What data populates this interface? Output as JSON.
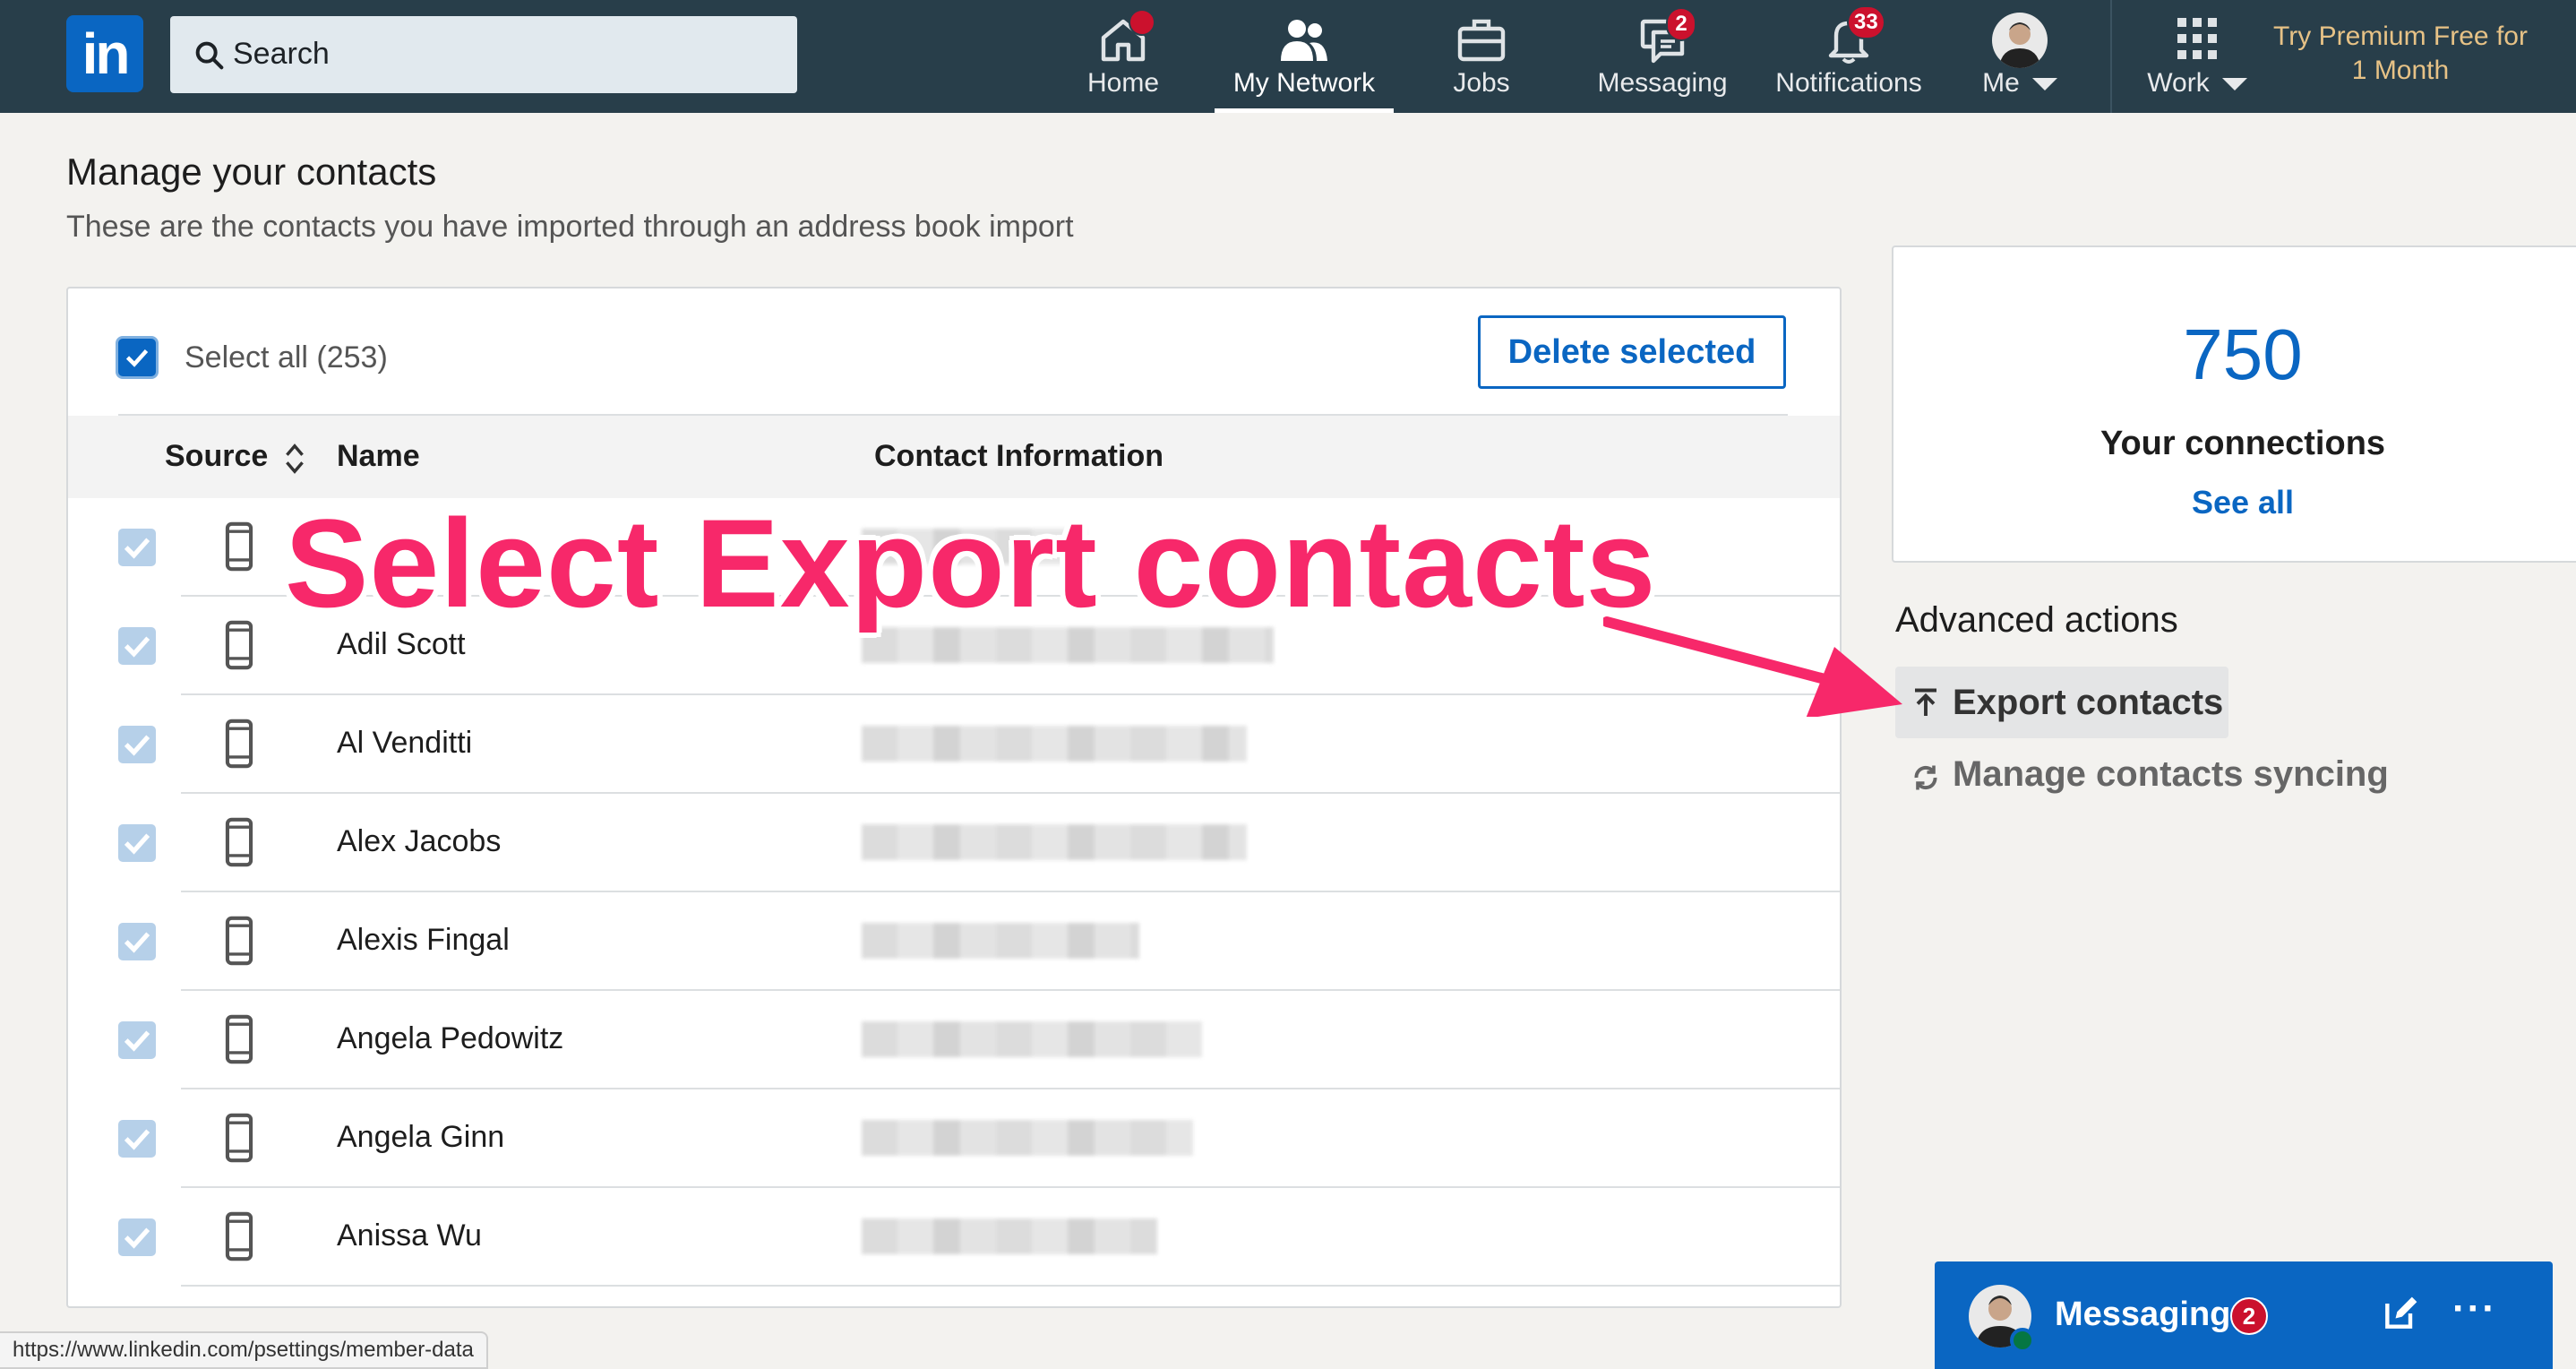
{
  "nav": {
    "logo_text": "in",
    "search_placeholder": "Search",
    "items": [
      {
        "label": "Home"
      },
      {
        "label": "My Network"
      },
      {
        "label": "Jobs"
      },
      {
        "label": "Messaging",
        "badge": "2"
      },
      {
        "label": "Notifications",
        "badge": "33"
      },
      {
        "label": "Me"
      },
      {
        "label": "Work"
      }
    ],
    "premium": "Try Premium Free for 1 Month"
  },
  "page": {
    "title": "Manage your contacts",
    "subtitle": "These are the contacts you have imported through an address book import"
  },
  "contacts": {
    "select_all_label": "Select all (253)",
    "delete_button": "Delete selected",
    "headers": {
      "source": "Source",
      "name": "Name",
      "contact": "Contact Information"
    },
    "rows": [
      {
        "name": ""
      },
      {
        "name": "Adil Scott"
      },
      {
        "name": "Al Venditti"
      },
      {
        "name": "Alex Jacobs"
      },
      {
        "name": "Alexis Fingal"
      },
      {
        "name": "Angela Pedowitz"
      },
      {
        "name": "Angela Ginn"
      },
      {
        "name": "Anissa Wu"
      }
    ]
  },
  "sidebar": {
    "connections_count": "750",
    "connections_label": "Your connections",
    "see_all": "See all",
    "advanced_title": "Advanced actions",
    "export_label": "Export contacts",
    "sync_label": "Manage contacts syncing"
  },
  "annotation": {
    "text": "Select Export contacts"
  },
  "messaging_dock": {
    "label": "Messaging",
    "badge": "2"
  },
  "status_url": "https://www.linkedin.com/psettings/member-data",
  "colors": {
    "nav_bg": "#283e4a",
    "brand_blue": "#0a66c2",
    "badge_red": "#cb112d",
    "annotation_pink": "#f7286a",
    "premium_gold": "#e7c286"
  }
}
